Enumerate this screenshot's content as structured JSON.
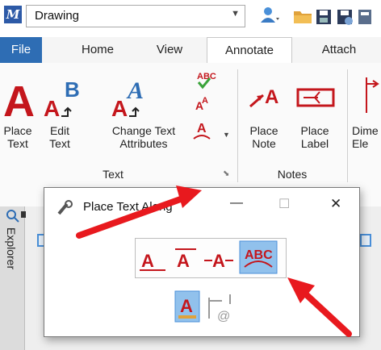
{
  "titlebar": {
    "workflow_value": "Drawing"
  },
  "ribbon_tabs": [
    "File",
    "Home",
    "View",
    "Annotate",
    "Attach"
  ],
  "ribbon": {
    "groups": {
      "text": "Text",
      "notes": "Notes"
    },
    "buttons": {
      "place_text": [
        "Place",
        "Text"
      ],
      "edit_text": [
        "Edit",
        "Text"
      ],
      "change_text_attributes": [
        "Change Text",
        "Attributes"
      ],
      "place_note": [
        "Place",
        "Note"
      ],
      "place_label": [
        "Place",
        "Label"
      ],
      "dimension_element": [
        "Dime",
        "Ele"
      ]
    },
    "small_icons": {
      "spell_check": "ABC",
      "text_size_glyph": "A"
    }
  },
  "explorer": {
    "tab_label": "Explorer"
  },
  "dialog": {
    "title": "Place Text Along",
    "controls": {
      "minimize": "—",
      "maximize": "☐",
      "close": "✕"
    },
    "modes": [
      "A",
      "A",
      "A",
      "ABC"
    ],
    "selected_mode": "ABC",
    "bottom_icons": [
      "A",
      "@"
    ]
  },
  "colors": {
    "file_tab": "#2e6db4",
    "accent_red": "#c4161c",
    "selected_bg": "#91c1ec",
    "arrow_red": "#e8191e"
  }
}
